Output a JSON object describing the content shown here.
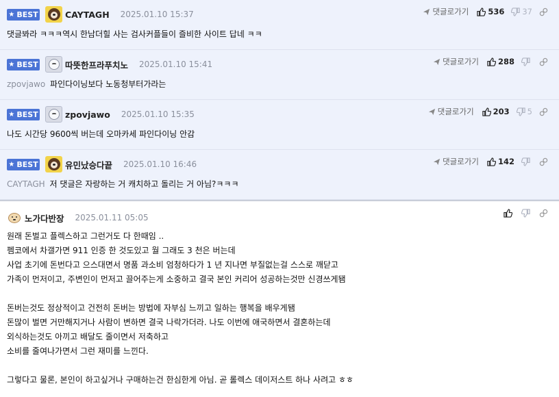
{
  "labels": {
    "best": "BEST",
    "reply": "댓글로가기"
  },
  "colors": {
    "best_badge": "#4b74d6",
    "best_bg": "#eef2fc",
    "muted": "#8a8f9c"
  },
  "icons": {
    "reply": "arrow-reply-icon",
    "up": "thumbs-up-icon",
    "down": "thumbs-down-icon",
    "link": "link-icon",
    "best": "star-icon"
  },
  "comments": [
    {
      "best": true,
      "avatar": "dog-avatar",
      "nick": "CAYTAGH",
      "date": "2025.01.10 15:37",
      "mention": "",
      "text": "댓글봐라 ㅋㅋㅋ역시 한남더힐 사는 검사커플들이 즐비한 사이트 답네 ㅋㅋ",
      "up": "536",
      "down": "37"
    },
    {
      "best": true,
      "avatar": "gray-avatar",
      "nick": "따뜻한프라푸치노",
      "date": "2025.01.10 15:41",
      "mention": "zpovjawo",
      "text": "파인다이닝보다 노동청부터가라는",
      "up": "288",
      "down": ""
    },
    {
      "best": true,
      "avatar": "gray-avatar",
      "nick": "zpovjawo",
      "date": "2025.01.10 15:35",
      "mention": "",
      "text": "나도 시간당 9600씩 버는데 오마카세 파인다이닝 안감",
      "up": "203",
      "down": "5"
    },
    {
      "best": true,
      "avatar": "dog-avatar",
      "nick": "유민났승다끝",
      "date": "2025.01.10 16:46",
      "mention": "CAYTAGH",
      "text": "저 댓글은 자랑하는 거 캐치하고 돌리는 거 아님?ㅋㅋㅋ",
      "up": "142",
      "down": ""
    }
  ],
  "normal_comment": {
    "avatar": "puppy-avatar",
    "nick": "노가다반장",
    "date": "2025.01.11 05:05",
    "lines": [
      "원래 돈벌고 플렉스하고 그런거도 다 한때임 ..",
      "펨코에서 차갤가면 911 인증 한 것도있고 월 그래도 3 천은 버는데",
      "사업 초기에 돈번다고 으스대면서 명품 과소비 엄청하다가 1 년 지나면 부질없는걸 스스로 깨닫고",
      "가족이 먼저이고, 주변인이 먼저고 끌어주는게 소중하고 결국 본인 커리어 성공하는것만 신경쓰게됌",
      "",
      "돈버는것도 정상적이고 건전히 돈버는 방법에 자부심 느끼고 일하는 행복을 배우게됌",
      "돈많이 벌면 거만해지거나 사람이 변하면 결국 나락가더라. 나도 이번에 애국하면서 결혼하는데",
      "외식하는것도 아끼고 배달도 줄이면서 저축하고",
      "소비를 줄여나가면서 그런 재미를 느낀다.",
      "",
      "그렇다고 물론, 본인이 하고싶거나 구매하는건 한심한게 아님. 곧 롤렉스 데이저스트 하나 사려고 ㅎㅎ"
    ]
  }
}
